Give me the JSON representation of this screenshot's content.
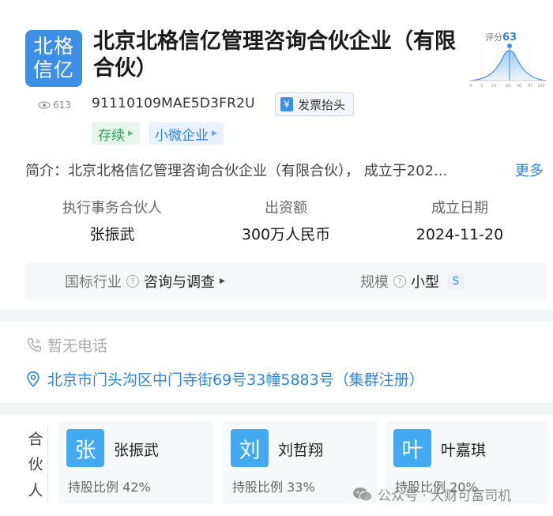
{
  "company": {
    "logo_lines": [
      "北格",
      "信亿"
    ],
    "name": "北京北格信亿管理咨询合伙企业（有限合伙）",
    "views": "613",
    "credit_code": "91110109MAE5D3FR2U",
    "invoice_label": "发票抬头",
    "tags": {
      "status": "存续",
      "scale": "小微企业"
    },
    "score": {
      "label": "评分",
      "value": "63",
      "axis_ticks": [
        "0",
        "3",
        "15",
        "60",
        "90",
        "97",
        "100"
      ]
    }
  },
  "intro": {
    "label": "简介：",
    "text": "北京北格信亿管理咨询合伙企业（有限合伙）， 成立于202...",
    "more": "更多"
  },
  "info": [
    {
      "label": "执行事务合伙人",
      "value": "张振武"
    },
    {
      "label": "出资额",
      "value": "300万人民币"
    },
    {
      "label": "成立日期",
      "value": "2024-11-20"
    }
  ],
  "industry": {
    "label": "国标行业",
    "value": "咨询与调查",
    "scale_label": "规模",
    "scale_value": "小型",
    "scale_badge": "S"
  },
  "contact": {
    "phone": "暂无电话",
    "address": "北京市门头沟区中门寺街69号33幢5883号（集群注册）"
  },
  "partners": {
    "label_chars": [
      "合",
      "伙",
      "人"
    ],
    "items": [
      {
        "avatar": "张",
        "name": "张振武",
        "share": "持股比例 42%"
      },
      {
        "avatar": "刘",
        "name": "刘哲翔",
        "share": "持股比例 33%"
      },
      {
        "avatar": "叶",
        "name": "叶嘉琪",
        "share": "持股比例 20%"
      }
    ]
  },
  "watermark": "公众号 · 大财可富司机",
  "colors": {
    "brand_blue": "#3d8fe6",
    "status_green": "#27a35a",
    "link_blue": "#2f83e0"
  }
}
